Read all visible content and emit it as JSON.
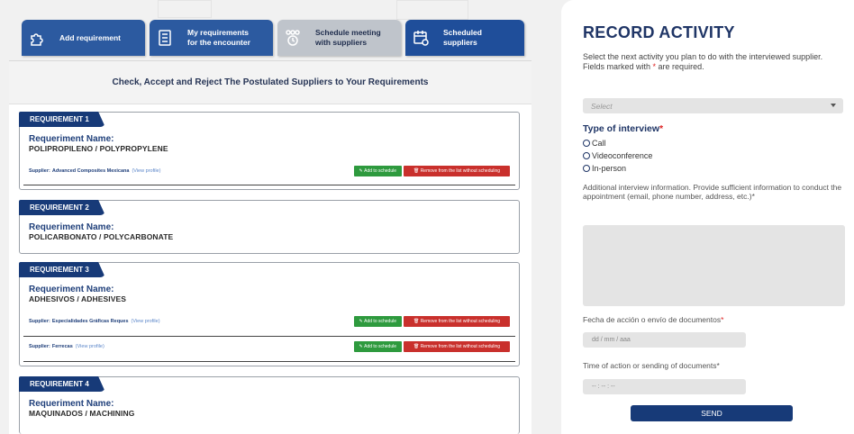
{
  "tabs": [
    {
      "label": "Add requirement",
      "icon": "puzzle-icon",
      "state": "active"
    },
    {
      "label": "My requirements\nfor the encounter",
      "icon": "list-icon",
      "state": "active"
    },
    {
      "label": "Schedule meeting\nwith suppliers",
      "icon": "meeting-icon",
      "state": "current"
    },
    {
      "label": "Scheduled\nsuppliers",
      "icon": "calendar-icon",
      "state": "active"
    }
  ],
  "panel": {
    "heading": "Check, Accept and Reject The Postulated Suppliers to Your Requirements"
  },
  "common": {
    "requirement_name_label": "Requeriment Name:",
    "supplier_label": "Supplier:",
    "view_profile": "(View profile)",
    "add_button": "Add to schedule",
    "remove_button": "Remove from the list without scheduling"
  },
  "requirements": [
    {
      "tag": "REQUIREMENT 1",
      "name": "POLIPROPILENO / POLYPROPYLENE",
      "suppliers": [
        {
          "name": "Advanced Composites Mexicana"
        }
      ]
    },
    {
      "tag": "REQUIREMENT 2",
      "name": "POLICARBONATO / POLYCARBONATE",
      "suppliers": []
    },
    {
      "tag": "REQUIREMENT 3",
      "name": "ADHESIVOS / ADHESIVES",
      "suppliers": [
        {
          "name": "Especialidades Gráficas Reques"
        },
        {
          "name": "Ferrecas"
        }
      ]
    },
    {
      "tag": "REQUIREMENT 4",
      "name": "MAQUINADOS / MACHINING",
      "suppliers": []
    }
  ],
  "record": {
    "title": "RECORD ACTIVITY",
    "intro_line1": "Select the next activity you plan to do with the interviewed supplier.",
    "intro_line2_a": "Fields marked with ",
    "intro_line2_star": "*",
    "intro_line2_b": " are required.",
    "select_placeholder": "Select",
    "type_label": "Type of interview",
    "required_star": "*",
    "options": [
      "Call",
      "Videoconference",
      "In-person"
    ],
    "info_text": "Additional interview information. Provide sufficient information to conduct the appointment (email, phone number, address, etc.)*",
    "date_label": "Fecha de acción o envío de documentos",
    "date_placeholder": "dd / mm / aaa",
    "time_label": "Time of action or sending of documents*",
    "time_placeholder": "-- : -- : --",
    "send_label": "SEND"
  },
  "colors": {
    "navy": "#173a78",
    "tab_blue": "#2c5aa0",
    "tab_grey": "#bfc4cb",
    "green": "#2e9a3e",
    "red": "#c9302c"
  }
}
